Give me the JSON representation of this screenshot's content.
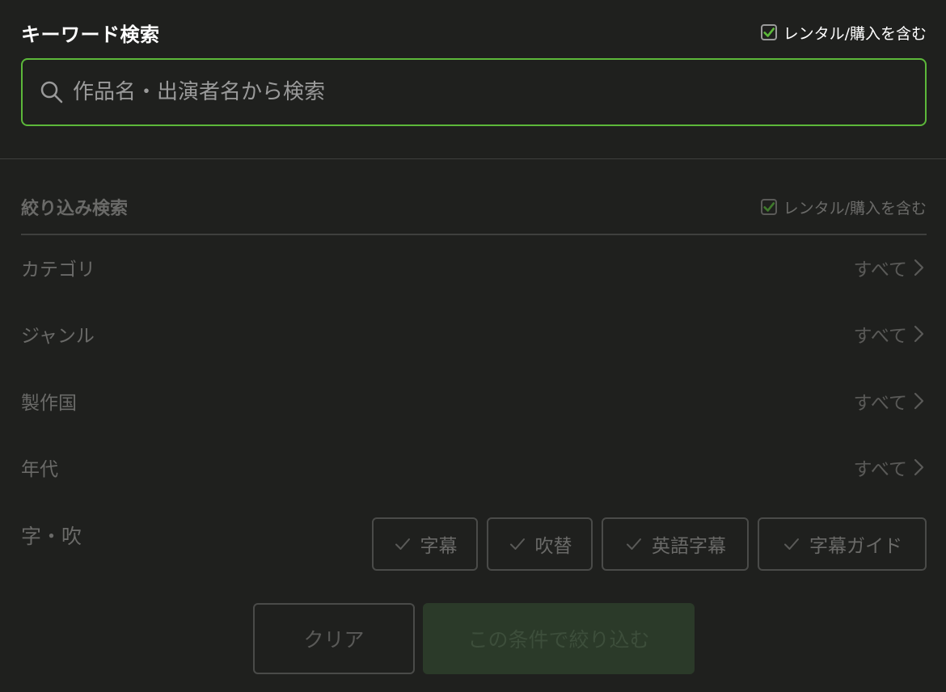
{
  "keyword": {
    "title": "キーワード検索",
    "rental_label": "レンタル/購入を含む",
    "rental_checked": true,
    "search_placeholder": "作品名・出演者名から検索",
    "search_value": ""
  },
  "filter": {
    "title": "絞り込み検索",
    "rental_label": "レンタル/購入を含む",
    "rental_checked": true,
    "rows": [
      {
        "label": "カテゴリ",
        "value": "すべて"
      },
      {
        "label": "ジャンル",
        "value": "すべて"
      },
      {
        "label": "製作国",
        "value": "すべて"
      },
      {
        "label": "年代",
        "value": "すべて"
      }
    ],
    "subtitle_label": "字・吹",
    "chips": [
      {
        "label": "字幕"
      },
      {
        "label": "吹替"
      },
      {
        "label": "英語字幕"
      },
      {
        "label": "字幕ガイド"
      }
    ]
  },
  "buttons": {
    "clear": "クリア",
    "apply": "この条件で絞り込む"
  },
  "colors": {
    "background": "#1f201e",
    "accent": "#5cb83a",
    "muted_text": "#6a6a68",
    "apply_button_bg": "#2b3a29"
  },
  "icons": {
    "search": "search-icon",
    "check": "check-icon",
    "chevron": "chevron-right-icon"
  }
}
